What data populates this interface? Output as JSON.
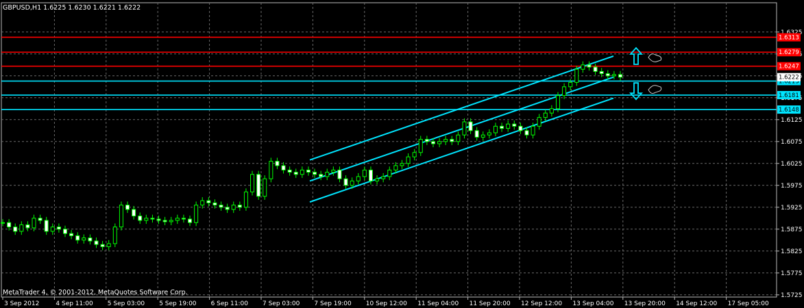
{
  "chart_header": "GBPUSD,H1  1.6225 1.6230 1.6221 1.6222",
  "footer": "MetaTrader 4, © 2001-2012, MetaQuotes Software Corp.",
  "chart_data": {
    "type": "candlestick",
    "symbol": "GBPUSD",
    "timeframe": "H1",
    "ohlc_last": {
      "open": 1.6225,
      "high": 1.623,
      "low": 1.6221,
      "close": 1.6222
    },
    "ylim": [
      1.572,
      1.637
    ],
    "y_ticks": [
      "1.6325",
      "1.6275",
      "1.6225",
      "1.6175",
      "1.6125",
      "1.6075",
      "1.6025",
      "1.5975",
      "1.5925",
      "1.5875",
      "1.5825",
      "1.5775",
      "1.5725"
    ],
    "x_ticks": [
      "3 Sep 2012",
      "4 Sep 11:00",
      "5 Sep 03:00",
      "5 Sep 19:00",
      "6 Sep 11:00",
      "7 Sep 03:00",
      "7 Sep 19:00",
      "10 Sep 12:00",
      "11 Sep 04:00",
      "11 Sep 20:00",
      "12 Sep 12:00",
      "13 Sep 04:00",
      "13 Sep 20:00",
      "14 Sep 12:00",
      "17 Sep 05:00"
    ],
    "price_series": [
      1.589,
      1.588,
      1.587,
      1.5885,
      1.5878,
      1.59,
      1.5895,
      1.587,
      1.588,
      1.5875,
      1.5865,
      1.586,
      1.585,
      1.5855,
      1.5848,
      1.584,
      1.5835,
      1.5842,
      1.588,
      1.593,
      1.592,
      1.5905,
      1.5895,
      1.59,
      1.5898,
      1.5895,
      1.5892,
      1.5895,
      1.59,
      1.5898,
      1.589,
      1.593,
      1.594,
      1.5935,
      1.593,
      1.5925,
      1.592,
      1.593,
      1.5925,
      1.596,
      1.6,
      1.595,
      1.599,
      1.603,
      1.602,
      1.601,
      1.6005,
      1.6,
      1.601,
      1.6005,
      1.6,
      1.5995,
      1.6005,
      1.601,
      1.599,
      1.5975,
      1.5985,
      1.5995,
      1.601,
      1.5985,
      1.599,
      1.5995,
      1.601,
      1.602,
      1.6025,
      1.604,
      1.605,
      1.608,
      1.6075,
      1.607,
      1.6075,
      1.608,
      1.6075,
      1.609,
      1.612,
      1.61,
      1.6085,
      1.609,
      1.6095,
      1.611,
      1.6105,
      1.6115,
      1.611,
      1.61,
      1.609,
      1.611,
      1.613,
      1.614,
      1.615,
      1.618,
      1.62,
      1.621,
      1.624,
      1.625,
      1.6245,
      1.6235,
      1.623,
      1.6225,
      1.6228,
      1.6222
    ],
    "horizontal_levels": [
      {
        "value": 1.6313,
        "color": "#ff0000",
        "label": "1.6313"
      },
      {
        "value": 1.6279,
        "color": "#ff0000",
        "label": "1.6279"
      },
      {
        "value": 1.6247,
        "color": "#ff0000",
        "label": "1.6247"
      },
      {
        "value": 1.6213,
        "color": "#00e5ff",
        "label": "1.6213"
      },
      {
        "value": 1.6181,
        "color": "#00e5ff",
        "label": "1.6181"
      },
      {
        "value": 1.6148,
        "color": "#00e5ff",
        "label": "1.6148"
      }
    ],
    "current_price": {
      "value": 1.6222,
      "label": "1.6222"
    },
    "channel_color": "#00e5ff",
    "candle_color": "#00ff00",
    "grid": true
  }
}
